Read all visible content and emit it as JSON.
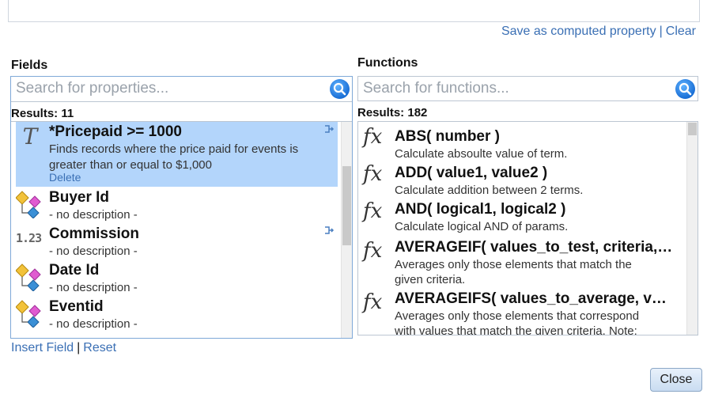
{
  "header": {
    "save_computed": "Save as computed property",
    "separator": "|",
    "clear": "Clear"
  },
  "fields": {
    "title": "Fields",
    "search_placeholder": "Search for properties...",
    "results_label": "Results: 11",
    "items": [
      {
        "name": "*Pricepaid >= 1000",
        "desc_line1": "Finds records where the price paid for events is",
        "desc_line2": "greater than or equal to $1,000",
        "action": "Delete",
        "icon": "text-type-icon",
        "selected": true
      },
      {
        "name": "Buyer Id",
        "desc_line1": "- no description -",
        "icon": "dimension-hierarchy-icon"
      },
      {
        "name": "Commission",
        "desc_line1": "- no description -",
        "icon": "number-type-icon",
        "icon_text": "1.23"
      },
      {
        "name": "Date Id",
        "desc_line1": "- no description -",
        "icon": "dimension-hierarchy-icon"
      },
      {
        "name": "Eventid",
        "desc_line1": "- no description -",
        "icon": "dimension-hierarchy-icon"
      }
    ],
    "insert_field": "Insert Field",
    "separator": "|",
    "reset": "Reset"
  },
  "functions": {
    "title": "Functions",
    "search_placeholder": "Search for functions...",
    "results_label": "Results: 182",
    "items": [
      {
        "name": "ABS( number )",
        "desc_line1": "Calculate absoulte value of term."
      },
      {
        "name": "ADD( value1, value2 )",
        "desc_line1": "Calculate addition between 2 terms."
      },
      {
        "name": "AND( logical1, logical2 )",
        "desc_line1": "Calculate logical AND of params."
      },
      {
        "name": "AVERAGEIF( values_to_test, criteria,…",
        "desc_line1": "Averages only those elements that match the",
        "desc_line2": "given criteria."
      },
      {
        "name": "AVERAGEIFS( values_to_average, v…",
        "desc_line1": "Averages only those elements that correspond",
        "desc_line2": "with values that match the given criteria. Note:"
      }
    ],
    "fx_glyph": "fx"
  },
  "footer": {
    "close": "Close"
  },
  "colors": {
    "link": "#3a6fb4",
    "selected_row": "#b3d5fb",
    "search_button": "#1a6fd6"
  }
}
